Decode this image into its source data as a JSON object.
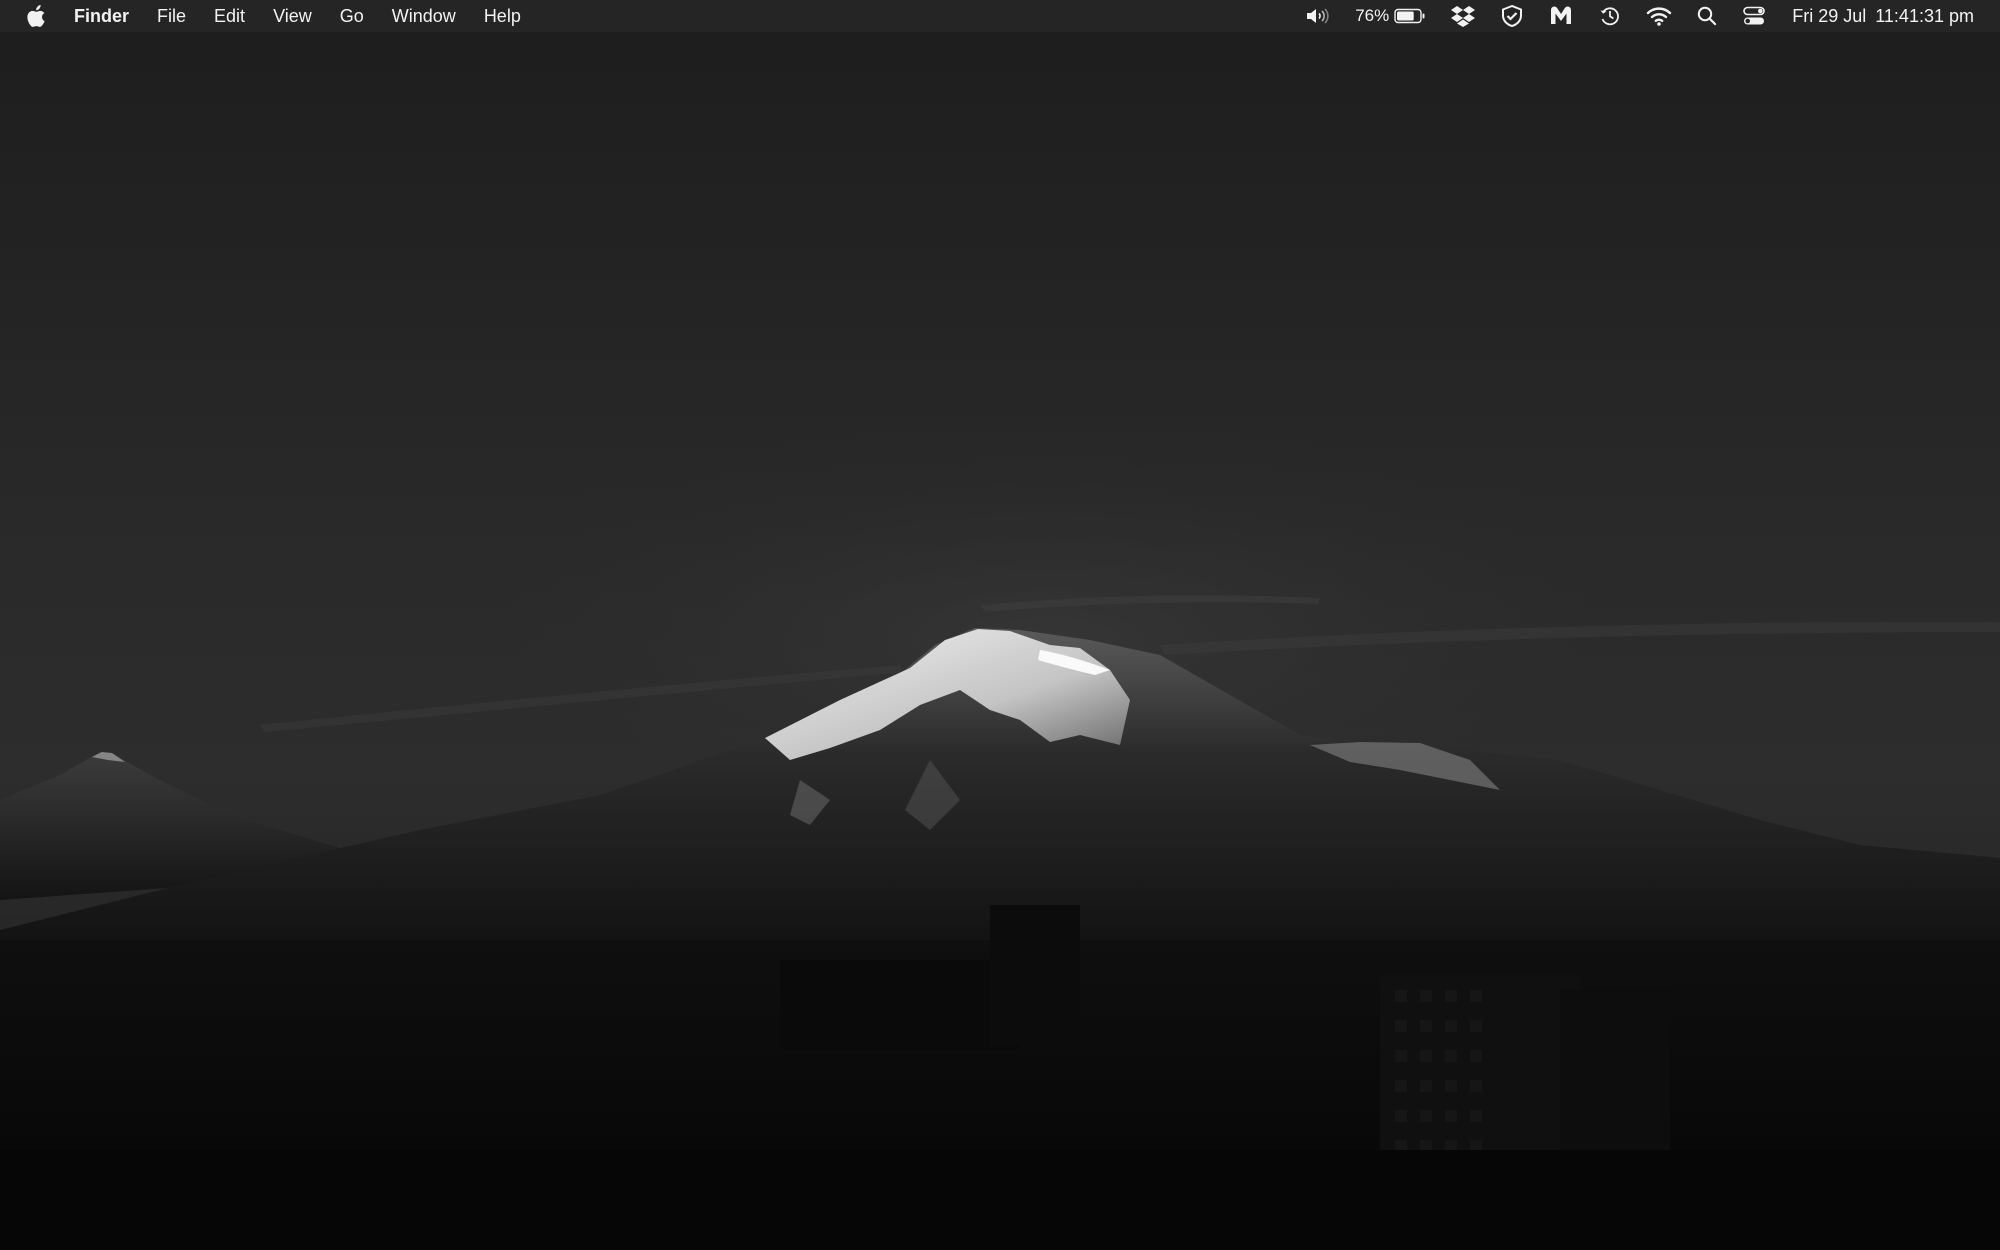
{
  "menubar": {
    "apple_icon": "apple-logo-icon",
    "app_name": "Finder",
    "menus": [
      "File",
      "Edit",
      "View",
      "Go",
      "Window",
      "Help"
    ],
    "status": {
      "volume_icon": "speaker-volume-icon",
      "battery_percent": "76%",
      "battery_level": 0.76,
      "battery_icon": "battery-icon",
      "dropbox_icon": "dropbox-icon",
      "shield_icon": "shield-check-icon",
      "malwarebytes_icon": "malwarebytes-icon",
      "timemachine_icon": "time-machine-icon",
      "wifi_icon": "wifi-icon",
      "spotlight_icon": "search-icon",
      "control_center_icon": "control-center-icon"
    },
    "date": "Fri 29 Jul",
    "time": "11:41:31 pm"
  },
  "colors": {
    "menubar_bg": "#262626",
    "menubar_text": "#f2f2f2"
  }
}
